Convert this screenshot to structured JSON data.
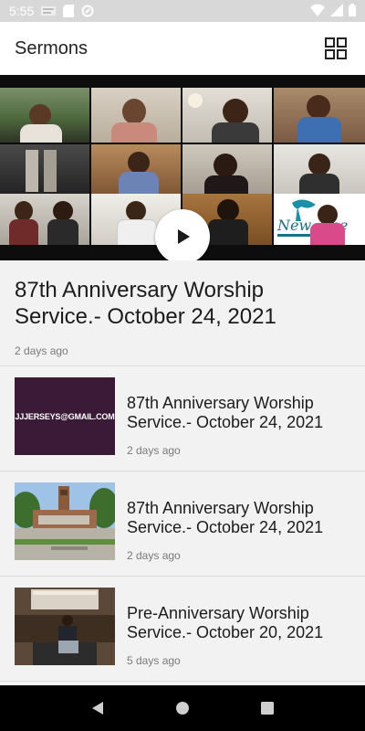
{
  "status_bar": {
    "time": "5:55",
    "icons": [
      "notification-app-icon",
      "sd-card-icon",
      "data-saver-icon",
      "wifi-icon",
      "signal-icon",
      "battery-icon"
    ]
  },
  "app_bar": {
    "title": "Sermons",
    "action_icon": "grid-view-icon"
  },
  "featured": {
    "title": "87th Anniversary Worship Service.- October 24, 2021",
    "date": "2 days ago",
    "play_icon": "play-icon",
    "thumbnail_logo_text": "New Hope"
  },
  "sermons": [
    {
      "title": "87th Anniversary Worship Service.- October 24, 2021",
      "date": "2 days ago",
      "thumbnail_text": "JJJERSEYS@GMAIL.COM"
    },
    {
      "title": "87th Anniversary Worship Service.- October 24, 2021",
      "date": "2 days ago"
    },
    {
      "title": "Pre-Anniversary Worship Service.- October 20, 2021",
      "date": "5 days ago"
    }
  ],
  "nav_bar": {
    "icons": [
      "back-icon",
      "home-icon",
      "recents-icon"
    ]
  },
  "colors": {
    "background": "#f2f2f2",
    "app_bar": "#ffffff",
    "nav_bar": "#000000",
    "divider": "#dcdcdc",
    "meta_text": "#7a7a7a"
  }
}
